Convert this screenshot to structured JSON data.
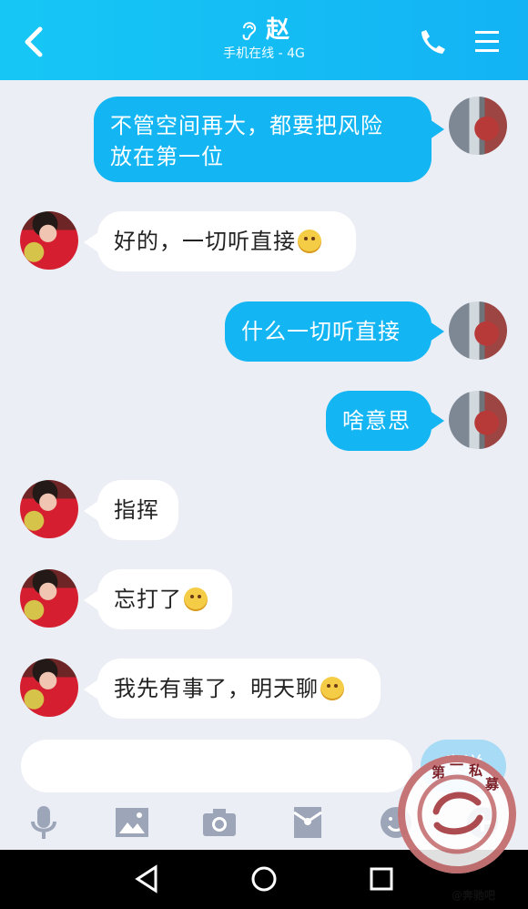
{
  "header": {
    "title": "赵",
    "status": "手机在线 - 4G",
    "back_icon": "chevron-left-icon",
    "call_icon": "phone-icon",
    "menu_icon": "menu-icon"
  },
  "messages": [
    {
      "from": "me",
      "text_line1": "不管空间再大，都要把风险",
      "text_line2": "放在第一位"
    },
    {
      "from": "other",
      "text": "好的，一切听直接",
      "emoji": "grinning-face"
    },
    {
      "from": "me",
      "text": "什么一切听直接"
    },
    {
      "from": "me",
      "text": "啥意思"
    },
    {
      "from": "other",
      "text": "指挥"
    },
    {
      "from": "other",
      "text": "忘打了",
      "emoji": "flushed-face"
    },
    {
      "from": "other",
      "text": "我先有事了，明天聊",
      "emoji": "thinking-face"
    }
  ],
  "composer": {
    "input_value": "",
    "send_label": "发送"
  },
  "toolbar": {
    "icons": [
      "microphone-icon",
      "image-icon",
      "camera-icon",
      "red-envelope-icon",
      "emoji-icon",
      "plus-icon"
    ]
  },
  "navigation": {
    "back": "back-triangle-icon",
    "home": "home-circle-icon",
    "recent": "recent-square-icon"
  },
  "watermark": {
    "circle_text": "第一私募",
    "source_text": "@奔驰吧"
  },
  "colors": {
    "header": "#13b3f4",
    "my_bubble": "#13b6f2",
    "other_bubble": "#ffffff",
    "background": "#eceef5"
  }
}
